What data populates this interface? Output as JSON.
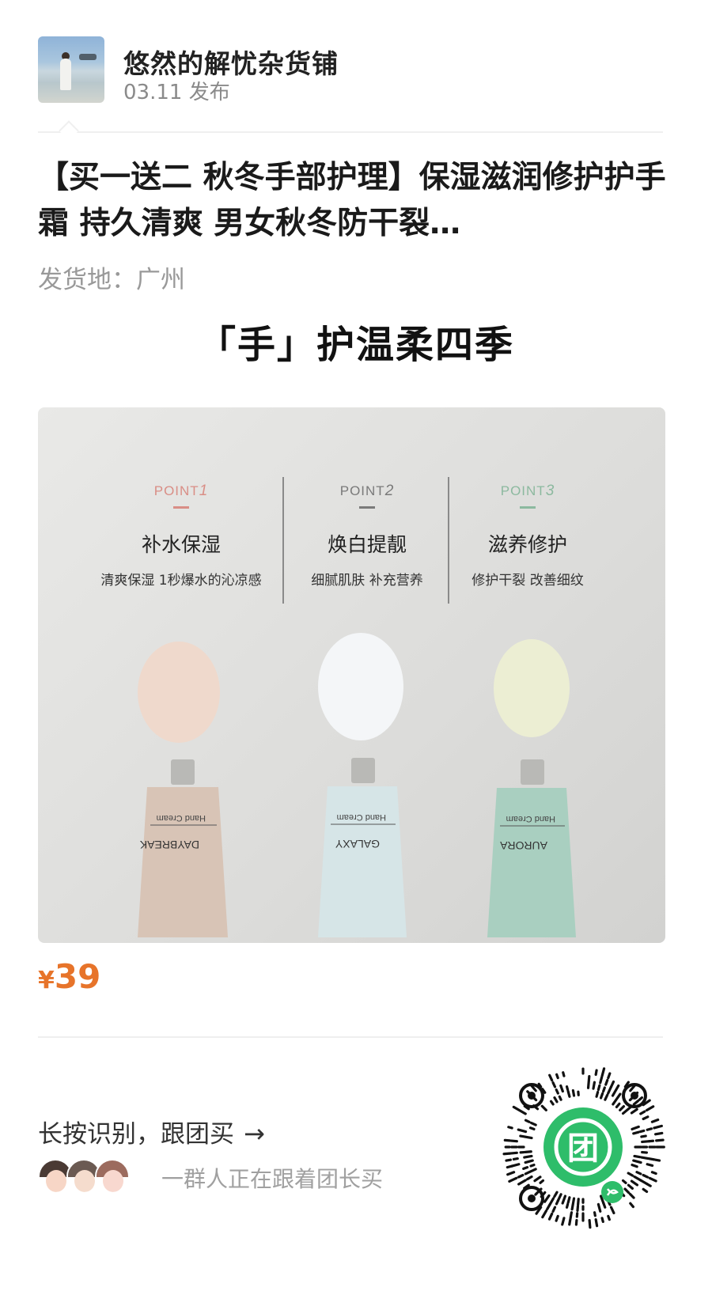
{
  "header": {
    "shop_name": "悠然的解忧杂货铺",
    "publish_time": "03.11 发布"
  },
  "product": {
    "title": "【买一送二 秋冬手部护理】保湿滋润修护护手霜 持久清爽 男女秋冬防干裂…",
    "ship_from": "发货地：广州",
    "slogan": "「手」护温柔四季",
    "price_symbol": "¥",
    "price": "39"
  },
  "image": {
    "points": [
      {
        "tag": "POINT",
        "num": "1",
        "title": "补水保湿",
        "desc": "清爽保湿 1秒爆水的沁凉感",
        "color": "#d98e86"
      },
      {
        "tag": "POINT",
        "num": "2",
        "title": "焕白提靓",
        "desc": "细腻肌肤 补充营养",
        "color": "#7a7a7a"
      },
      {
        "tag": "POINT",
        "num": "3",
        "title": "滋养修护",
        "desc": "修护干裂 改善细纹",
        "color": "#8cb99f"
      }
    ],
    "tubes": [
      {
        "brand": "DAYBREAK",
        "label": "Hand Cream",
        "color": "#d8c4b6",
        "cream": "#efd9cc"
      },
      {
        "brand": "GALAXY",
        "label": "Hand Cream",
        "color": "#d6e5e7",
        "cream": "#f4f6f8"
      },
      {
        "brand": "AURORA",
        "label": "Hand Cream",
        "color": "#a9cfc0",
        "cream": "#eceed3"
      }
    ]
  },
  "footer": {
    "cta": "长按识别，跟团买",
    "followers_text": "一群人正在跟着团长买",
    "qr_logo": "团"
  }
}
